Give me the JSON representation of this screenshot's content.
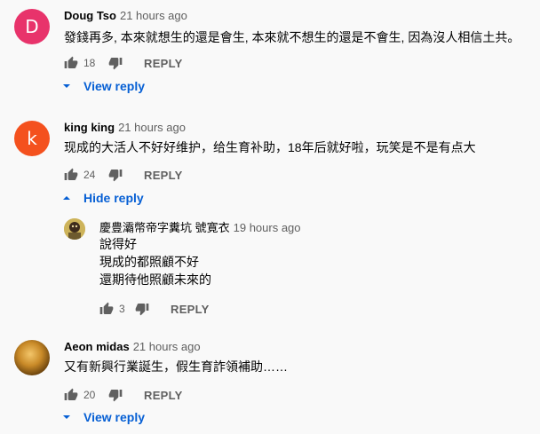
{
  "comments": [
    {
      "avatar_letter": "D",
      "avatar_color": "#e8336b",
      "author": "Doug Tso",
      "time": "21 hours ago",
      "text": "發錢再多, 本來就想生的還是會生, 本來就不想生的還是不會生, 因為沒人相信土共。",
      "likes": "18",
      "reply_label": "REPLY",
      "toggle_label": "View reply"
    },
    {
      "avatar_letter": "k",
      "avatar_color": "#f4511e",
      "author": "king king",
      "time": "21 hours ago",
      "text": "现成的大活人不好好维护，给生育补助，18年后就好啦，玩笑是不是有点大",
      "likes": "24",
      "reply_label": "REPLY",
      "toggle_label": "Hide reply",
      "reply": {
        "author": "慶豊灞幣帝字糞坑 號寛衣",
        "time": "19 hours ago",
        "lines": [
          "說得好",
          "現成的都照顧不好",
          "還期待他照顧未來的"
        ],
        "likes": "3",
        "reply_label": "REPLY"
      }
    },
    {
      "avatar_color": "#8a5a12",
      "author": "Aeon midas",
      "time": "21 hours ago",
      "text": "又有新興行業誕生，假生育詐領補助……",
      "likes": "20",
      "reply_label": "REPLY",
      "toggle_label": "View reply"
    }
  ]
}
